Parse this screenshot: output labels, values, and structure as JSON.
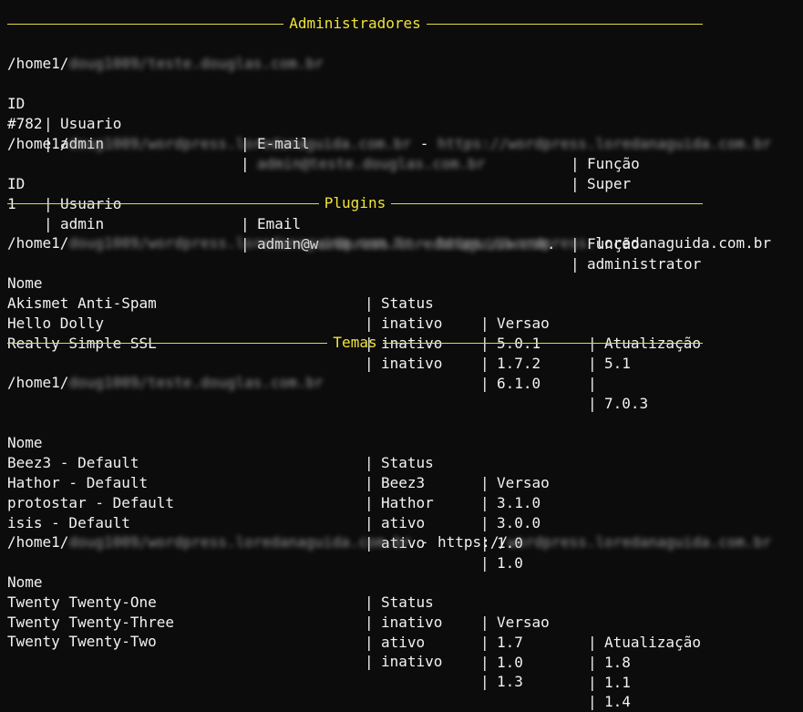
{
  "theme": {
    "accent": "#f0e33a",
    "rule": "#e5d84a",
    "background": "#0c0c0c",
    "text": "#f2f2f2"
  },
  "admins": {
    "title": "Administradores",
    "site1": {
      "path_prefix": "/home1/",
      "path_blurred": "doug1009/teste.douglas.com.br",
      "headers": [
        "ID",
        "Usuario",
        "E-mail",
        "Função"
      ],
      "rows": [
        {
          "id": "#782",
          "user": "admin",
          "email": "admin@teste.douglas.com.br",
          "role": "Super"
        }
      ]
    },
    "site2": {
      "path_prefix": "/home1/",
      "path_blurred": "doug1009",
      "path_suffix": "/wordpress.loredanaguida.com.br",
      "sep": " - ",
      "url": "https://wordpress.loredanaguida.com.br",
      "headers": [
        "ID",
        "Usuario",
        "Email",
        "Função"
      ],
      "rows": [
        {
          "id": "1",
          "user": "admin",
          "email_prefix": "admin@w",
          "email_blurred": "ordpress.loredanaguida.com",
          "email_suffix": ".",
          "role": "administrator"
        }
      ]
    }
  },
  "plugins": {
    "title": "Plugins",
    "path_prefix": "/home1/",
    "path_blurred": "doug1009/wordpress.loredanaguida.com.br - https://wordpress.",
    "path_tail": "loredanaguida.com.br",
    "headers": [
      "Nome",
      "Status",
      "Versao",
      "Atualização"
    ],
    "rows": [
      {
        "name": "Akismet Anti-Spam",
        "status": "inativo",
        "version": "5.0.1",
        "update": "5.1"
      },
      {
        "name": "Hello Dolly",
        "status": "inativo",
        "version": "1.7.2",
        "update": ""
      },
      {
        "name": "Really Simple SSL",
        "status": "inativo",
        "version": "6.1.0",
        "update": "7.0.3"
      }
    ]
  },
  "themes": {
    "title": "Temas",
    "site1": {
      "path_prefix": "/home1/",
      "path_blurred": "doug1009/teste.douglas.com.br",
      "headers": [
        "Nome",
        "Status",
        "Versao"
      ],
      "rows": [
        {
          "name": "Beez3 - Default",
          "status": "Beez3",
          "version": "3.1.0"
        },
        {
          "name": "Hathor - Default",
          "status": "Hathor",
          "version": "3.0.0"
        },
        {
          "name": "protostar - Default",
          "status": "ativo",
          "version": "1.0"
        },
        {
          "name": "isis - Default",
          "status": "ativo",
          "version": "1.0"
        }
      ]
    },
    "site2": {
      "path_prefix": "/home1/",
      "path_blurred": "doug1009/wordpress.loredanaguida.com.br",
      "sep": " - https://",
      "url_blurred": "wordpress.loredanaguida.com.br",
      "headers": [
        "Nome",
        "Status",
        "Versao",
        "Atualização"
      ],
      "rows": [
        {
          "name": "Twenty Twenty-One",
          "status": "inativo",
          "version": "1.7",
          "update": "1.8"
        },
        {
          "name": "Twenty Twenty-Three",
          "status": "ativo",
          "version": "1.0",
          "update": "1.1"
        },
        {
          "name": "Twenty Twenty-Two",
          "status": "inativo",
          "version": "1.3",
          "update": "1.4"
        }
      ]
    }
  }
}
